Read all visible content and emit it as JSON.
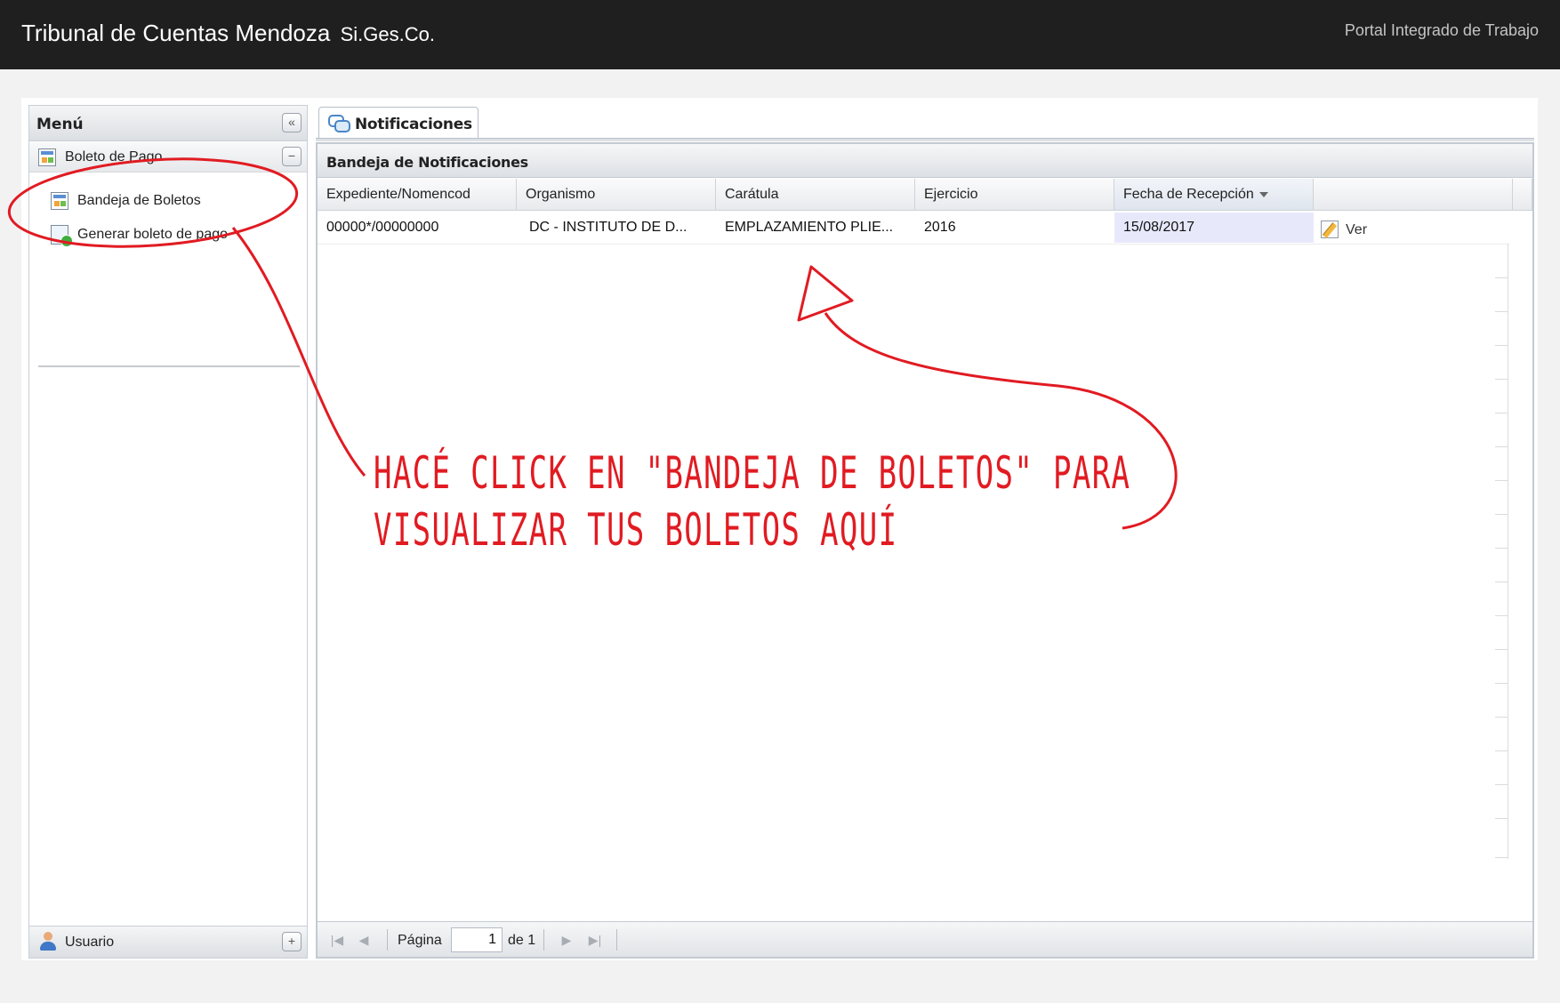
{
  "header": {
    "brand": "Tribunal de Cuentas Mendoza",
    "brand_sub": "Si.Ges.Co.",
    "portal": "Portal Integrado de Trabajo"
  },
  "sidebar": {
    "title": "Menú",
    "collapse_icon": "double-chevron-left-icon",
    "group": {
      "label": "Boleto de Pago",
      "items": [
        {
          "label": "Bandeja de Boletos",
          "icon": "boleto-icon"
        },
        {
          "label": "Generar boleto de pago",
          "icon": "generate-boleto-icon"
        }
      ]
    },
    "user_section": {
      "label": "Usuario"
    }
  },
  "main": {
    "tab": {
      "label": "Notificaciones"
    },
    "grid": {
      "title": "Bandeja de Notificaciones",
      "columns": [
        {
          "label": "Expediente/Nomencod"
        },
        {
          "label": "Organismo"
        },
        {
          "label": "Carátula"
        },
        {
          "label": "Ejercicio"
        },
        {
          "label": "Fecha de Recepción",
          "sorted": "desc"
        }
      ],
      "rows": [
        {
          "expediente": "00000*/00000000",
          "organismo": "DC - INSTITUTO DE D...",
          "caratula": "EMPLAZAMIENTO PLIE...",
          "ejercicio": "2016",
          "fecha": "15/08/2017",
          "action_label": "Ver"
        }
      ]
    },
    "pager": {
      "page_label": "Página",
      "current_page": "1",
      "of_label": "de 1"
    }
  },
  "annotation": {
    "line1": "HACÉ CLICK EN \"BANDEJA DE BOLETOS\" PARA",
    "line2": "VISUALIZAR TUS BOLETOS AQUÍ",
    "color": "#e11b22"
  }
}
